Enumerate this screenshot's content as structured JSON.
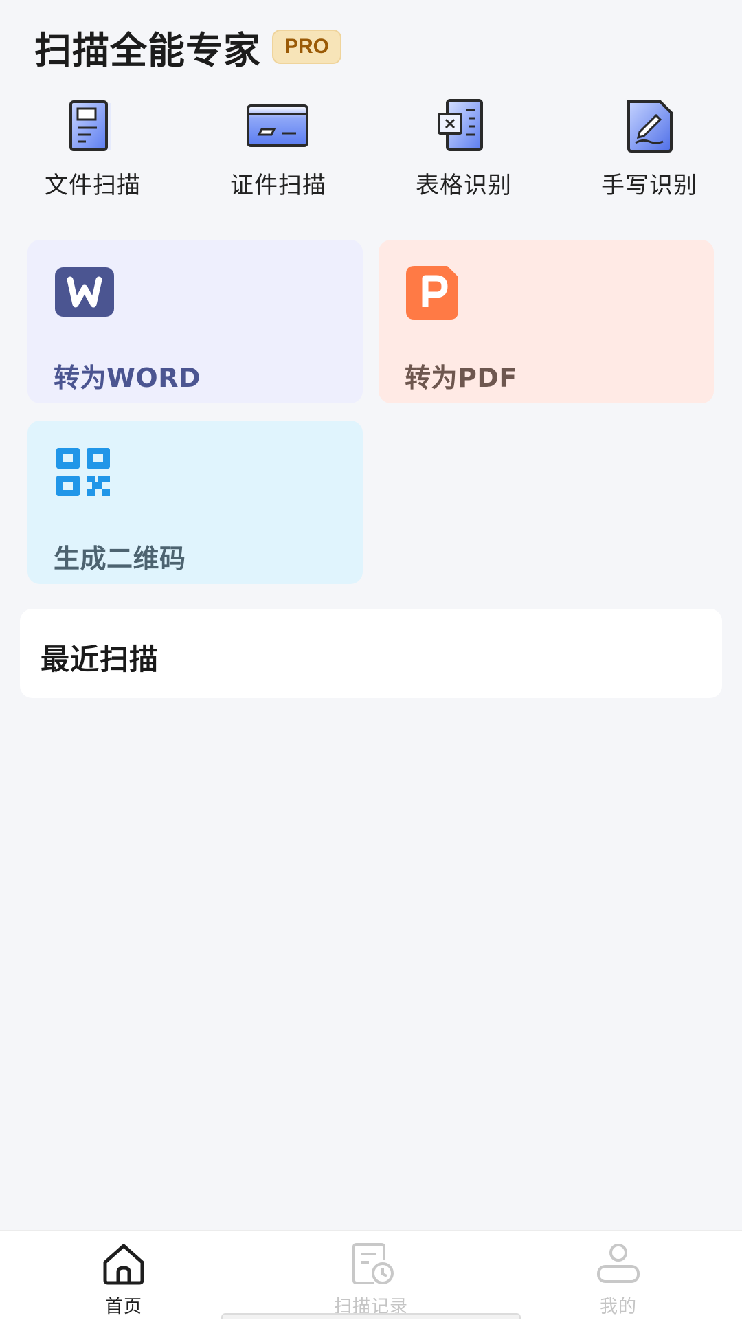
{
  "header": {
    "title": "扫描全能专家",
    "badge": "PRO"
  },
  "tools": [
    {
      "label": "文件扫描",
      "icon": "document-scan-icon"
    },
    {
      "label": "证件扫描",
      "icon": "id-card-icon"
    },
    {
      "label": "表格识别",
      "icon": "spreadsheet-icon"
    },
    {
      "label": "手写识别",
      "icon": "handwriting-icon"
    }
  ],
  "cards": {
    "word": {
      "label": "转为WORD",
      "icon": "word-icon",
      "color": "#4b5591"
    },
    "pdf": {
      "label": "转为PDF",
      "icon": "pdf-icon",
      "color": "#ff7a45"
    },
    "qr": {
      "label": "生成二维码",
      "icon": "qr-code-icon",
      "color": "#2196e8"
    }
  },
  "recent": {
    "title": "最近扫描"
  },
  "nav": [
    {
      "label": "首页",
      "icon": "home-icon",
      "active": true
    },
    {
      "label": "扫描记录",
      "icon": "scan-history-icon",
      "active": false
    },
    {
      "label": "我的",
      "icon": "profile-icon",
      "active": false
    }
  ]
}
